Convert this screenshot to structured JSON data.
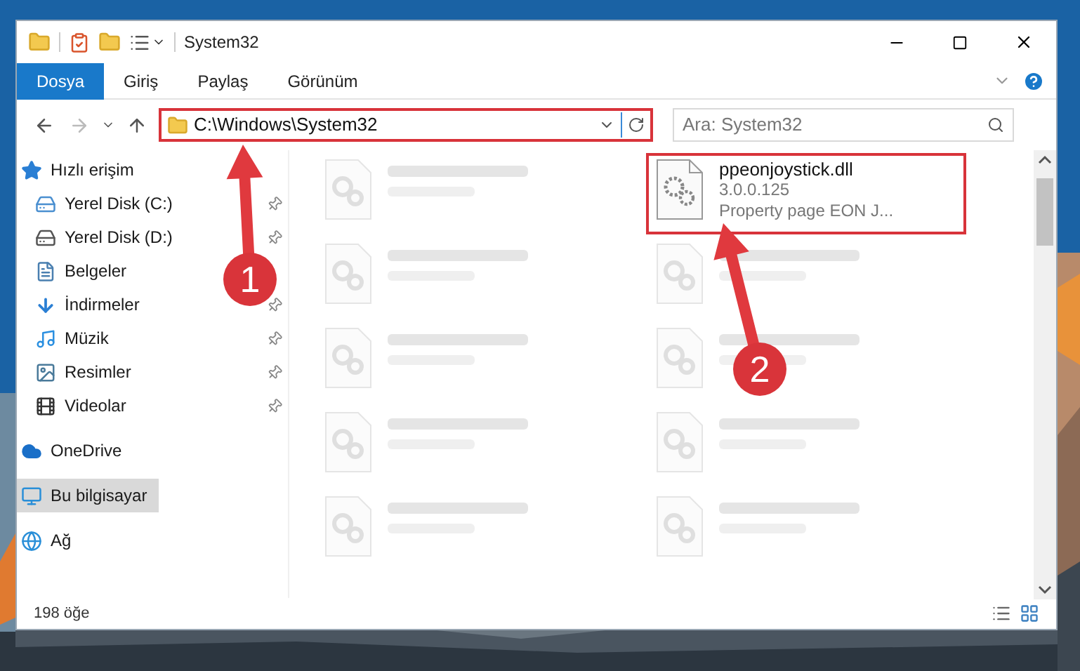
{
  "window": {
    "title": "System32"
  },
  "ribbon_tabs": [
    {
      "label": "Dosya",
      "selected": true
    },
    {
      "label": "Giriş",
      "selected": false
    },
    {
      "label": "Paylaş",
      "selected": false
    },
    {
      "label": "Görünüm",
      "selected": false
    }
  ],
  "address_bar": {
    "path": "C:\\Windows\\System32",
    "highlighted": true
  },
  "search": {
    "placeholder": "Ara: System32"
  },
  "sidebar": {
    "items": [
      {
        "label": "Hızlı erişim",
        "kind": "star",
        "selected": false,
        "children": [
          {
            "label": "Yerel Disk (C:)",
            "kind": "drive-c",
            "pinned": true,
            "selected": false
          },
          {
            "label": "Yerel Disk (D:)",
            "kind": "drive",
            "pinned": true,
            "selected": false
          },
          {
            "label": "Belgeler",
            "kind": "documents",
            "pinned": false,
            "selected": false
          },
          {
            "label": "İndirmeler",
            "kind": "downloads",
            "pinned": true,
            "selected": false
          },
          {
            "label": "Müzik",
            "kind": "music",
            "pinned": true,
            "selected": false
          },
          {
            "label": "Resimler",
            "kind": "pictures",
            "pinned": true,
            "selected": false
          },
          {
            "label": "Videolar",
            "kind": "videos",
            "pinned": true,
            "selected": false
          }
        ]
      },
      {
        "label": "OneDrive",
        "kind": "cloud",
        "selected": false
      },
      {
        "label": "Bu bilgisayar",
        "kind": "computer",
        "selected": true
      },
      {
        "label": "Ağ",
        "kind": "network",
        "selected": false
      }
    ]
  },
  "files": [
    {
      "kind": "blurred",
      "highlighted": false
    },
    {
      "kind": "file",
      "name": "ppeonjoystick.dll",
      "lines": [
        "3.0.0.125",
        "Property page EON J..."
      ],
      "highlighted": true
    },
    {
      "kind": "blurred",
      "highlighted": false
    },
    {
      "kind": "blurred",
      "highlighted": false
    },
    {
      "kind": "blurred",
      "highlighted": false
    },
    {
      "kind": "blurred",
      "highlighted": false
    },
    {
      "kind": "blurred",
      "highlighted": false
    },
    {
      "kind": "blurred",
      "highlighted": false
    },
    {
      "kind": "blurred",
      "highlighted": false
    },
    {
      "kind": "blurred",
      "highlighted": false
    }
  ],
  "status_bar": {
    "item_count": "198 öğe"
  },
  "annotations": [
    {
      "number": "1"
    },
    {
      "number": "2"
    }
  ]
}
